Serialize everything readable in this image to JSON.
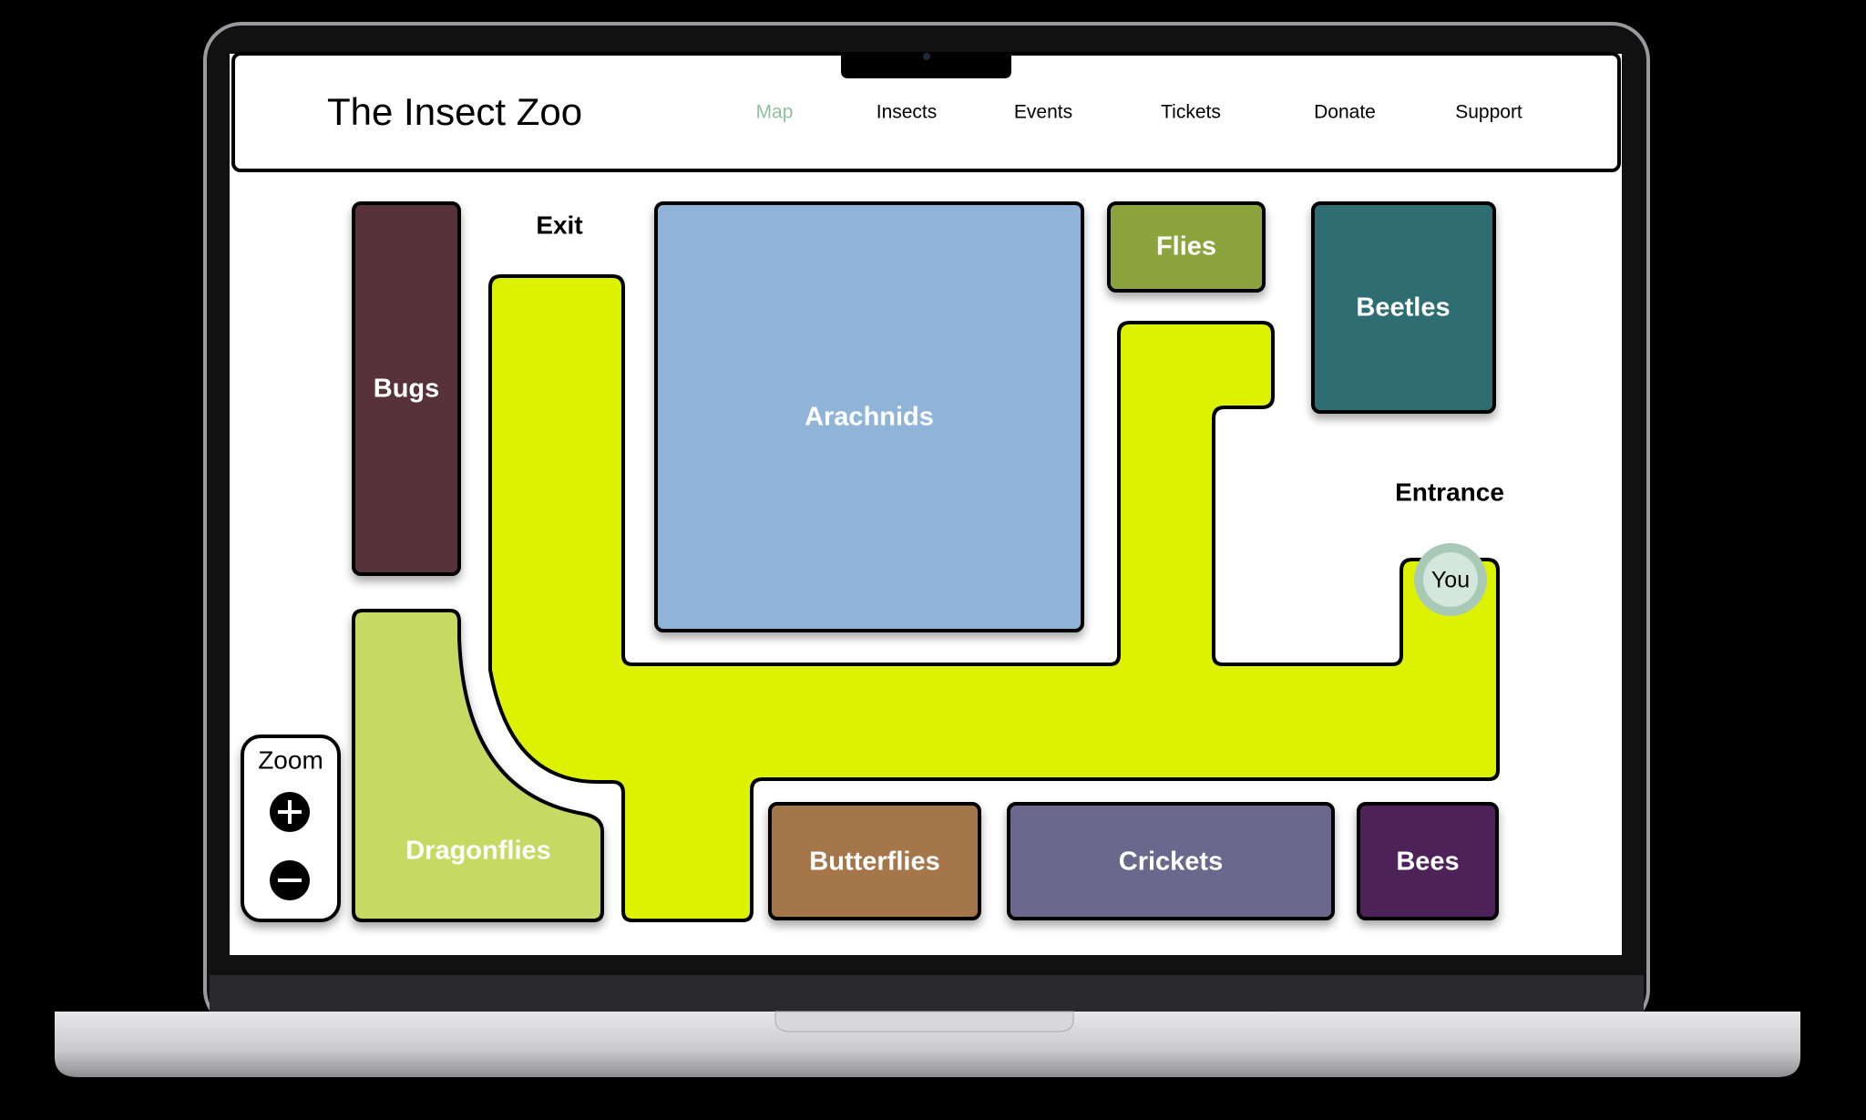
{
  "header": {
    "title": "The Insect Zoo",
    "nav": [
      {
        "label": "Map",
        "active": true
      },
      {
        "label": "Insects"
      },
      {
        "label": "Events"
      },
      {
        "label": "Tickets"
      },
      {
        "label": "Donate"
      },
      {
        "label": "Support"
      }
    ],
    "active_color": "#8fc19a"
  },
  "map": {
    "rooms": {
      "bugs": {
        "label": "Bugs",
        "color": "#58303b"
      },
      "arachnids": {
        "label": "Arachnids",
        "color": "#8fb4d8"
      },
      "flies": {
        "label": "Flies",
        "color": "#8ca43c"
      },
      "beetles": {
        "label": "Beetles",
        "color": "#2d6e72"
      },
      "dragonflies": {
        "label": "Dragonflies",
        "color": "#c6d962"
      },
      "butterflies": {
        "label": "Butterflies",
        "color": "#a6764b"
      },
      "crickets": {
        "label": "Crickets",
        "color": "#6a698d"
      },
      "bees": {
        "label": "Bees",
        "color": "#4d2459"
      }
    },
    "path_color": "#dcf200",
    "exit_label": "Exit",
    "entrance_label": "Entrance",
    "you_label": "You",
    "zoom": {
      "label": "Zoom",
      "in": "+",
      "out": "−"
    }
  }
}
